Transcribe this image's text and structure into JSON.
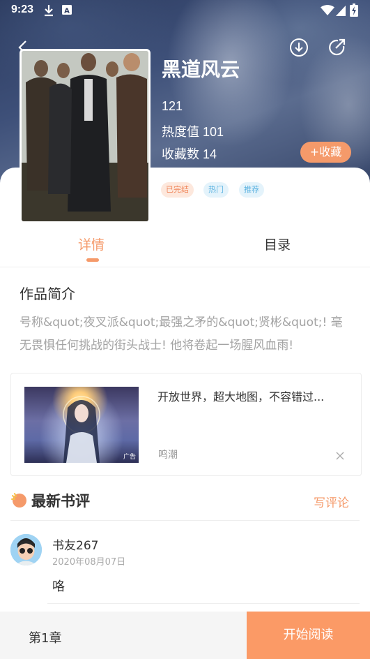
{
  "status_bar": {
    "time": "9:23",
    "icons": [
      "download-icon",
      "a-icon",
      "wifi-icon",
      "signal-icon",
      "battery-icon"
    ]
  },
  "header": {
    "back_icon": "chevron-left-icon",
    "download_icon": "download-circle-icon",
    "share_icon": "share-icon"
  },
  "book": {
    "title": "黑道风云",
    "number": "121",
    "heat": "热度值 101",
    "favorites": "收藏数 14",
    "fav_button": "+收藏",
    "tags": [
      "已完结",
      "热门",
      "推荐"
    ]
  },
  "tabs": [
    "详情",
    "目录"
  ],
  "synopsis": {
    "title": "作品简介",
    "text": "号称&quot;夜叉派&quot;最强之矛的&quot;贤彬&quot;! 毫无畏惧任何挑战的街头战士! 他将卷起一场腥风血雨!"
  },
  "ad": {
    "title": "开放世界，超大地图，不容错过...",
    "source": "鸣潮",
    "badge": "广告"
  },
  "reviews": {
    "title": "最新书评",
    "write_label": "写评论",
    "items": [
      {
        "user": "书友267",
        "date": "2020年08月07日",
        "text": "咯"
      }
    ]
  },
  "bottom": {
    "chapter": "第1章",
    "read_button": "开始阅读"
  },
  "colors": {
    "accent": "#f59a6a",
    "tag_done_bg": "#fde8dd",
    "tag_done_fg": "#f0865a",
    "tag_blue_bg": "#e4f3fb",
    "tag_blue_fg": "#5bb2e0"
  }
}
